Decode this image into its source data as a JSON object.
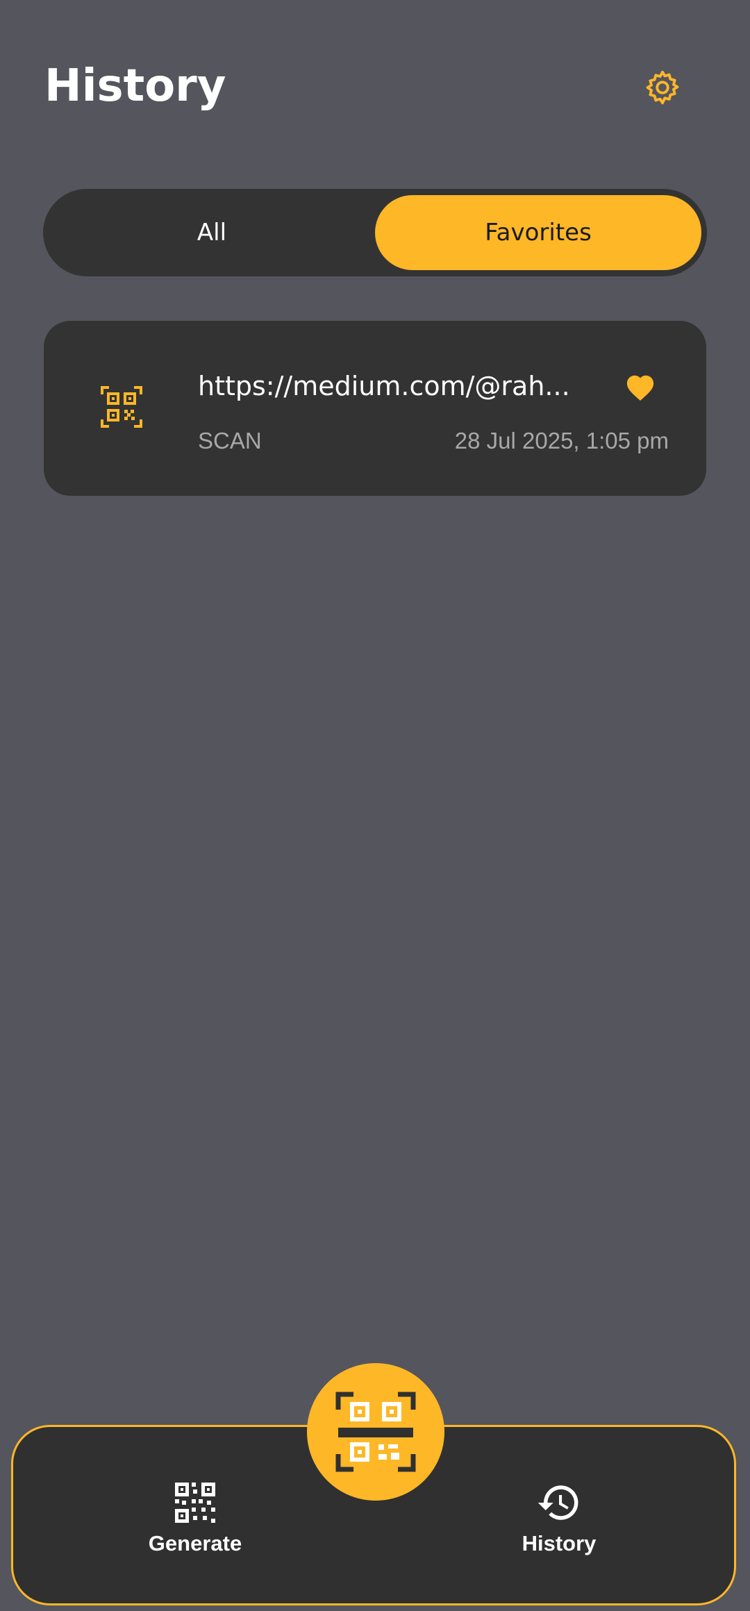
{
  "header": {
    "title": "History",
    "settings_icon": "gear-icon"
  },
  "tabs": [
    {
      "label": "All",
      "selected": false
    },
    {
      "label": "Favorites",
      "selected": true
    }
  ],
  "history_items": [
    {
      "icon": "qr-scan-icon",
      "content": "https://medium.com/@rah...",
      "type": "SCAN",
      "date": "28 Jul 2025, 1:05 pm",
      "favorite": true
    }
  ],
  "bottom_nav": {
    "items": [
      {
        "label": "Generate",
        "icon": "qr-code-icon"
      },
      {
        "label": "History",
        "icon": "history-icon"
      }
    ],
    "fab_icon": "qr-scanner-icon"
  },
  "colors": {
    "background": "#55555e",
    "surface": "#333333",
    "accent": "#fdb727",
    "text_primary": "#ffffff",
    "text_secondary": "#a8a8a8"
  }
}
